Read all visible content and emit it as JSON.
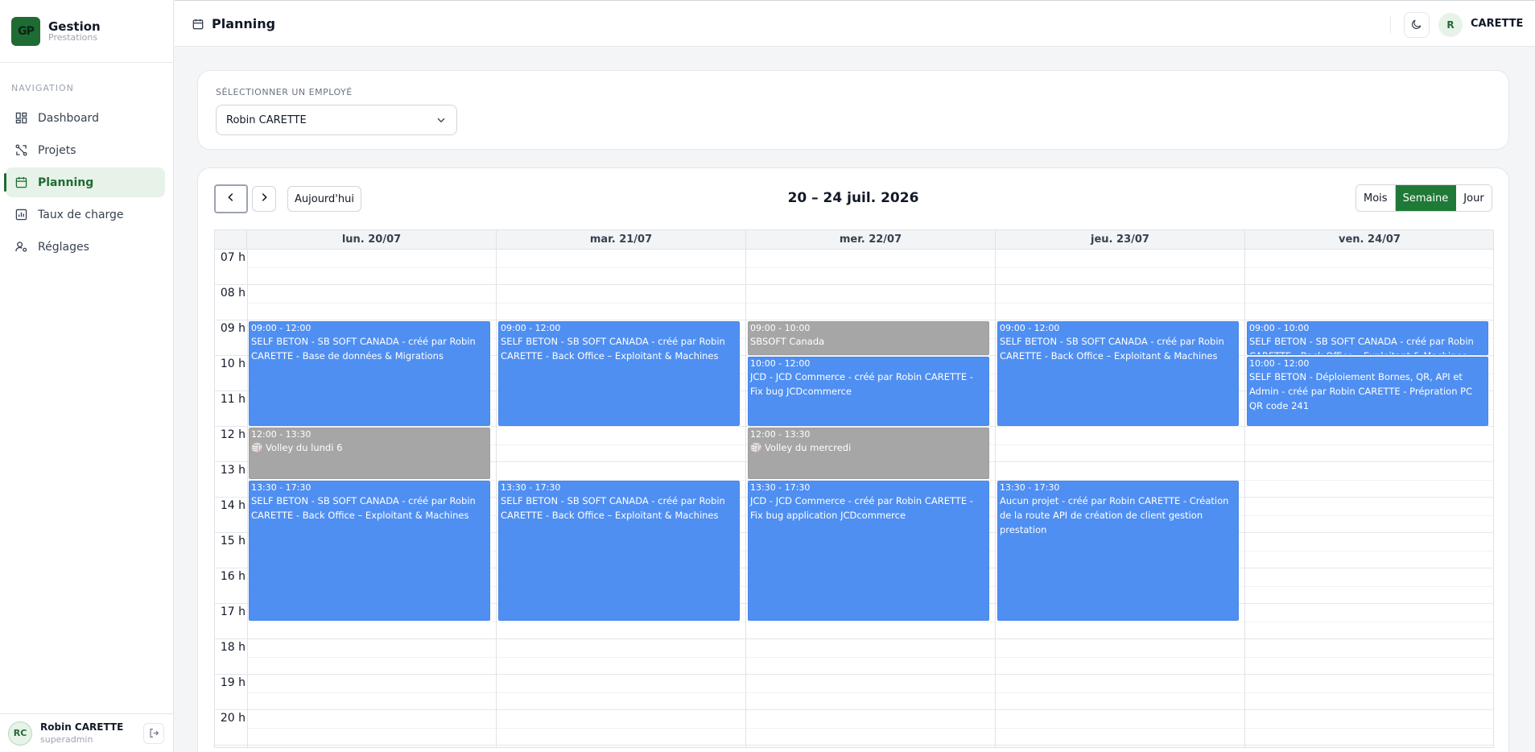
{
  "brand": {
    "logo": "GP",
    "title": "Gestion",
    "subtitle": "Prestations"
  },
  "nav": {
    "label": "NAVIGATION",
    "items": [
      {
        "label": "Dashboard",
        "icon": "dashboard-icon"
      },
      {
        "label": "Projets",
        "icon": "projects-icon"
      },
      {
        "label": "Planning",
        "icon": "calendar-icon",
        "active": true
      },
      {
        "label": "Taux de charge",
        "icon": "chart-icon"
      },
      {
        "label": "Réglages",
        "icon": "settings-icon"
      }
    ]
  },
  "user": {
    "initials": "RC",
    "name": "Robin CARETTE",
    "role": "superadmin"
  },
  "header": {
    "title": "Planning",
    "avatar": "R",
    "user": "CARETTE"
  },
  "employee": {
    "label": "SÉLECTIONNER UN EMPLOYÉ",
    "selected": "Robin CARETTE"
  },
  "calendar": {
    "today_label": "Aujourd'hui",
    "range_title": "20 – 24 juil. 2026",
    "views": [
      "Mois",
      "Semaine",
      "Jour"
    ],
    "active_view": "Semaine",
    "days": [
      "lun. 20/07",
      "mar. 21/07",
      "mer. 22/07",
      "jeu. 23/07",
      "ven. 24/07"
    ],
    "hours": [
      "07 h",
      "08 h",
      "09 h",
      "10 h",
      "11 h",
      "12 h",
      "13 h",
      "14 h",
      "15 h",
      "16 h",
      "17 h",
      "18 h",
      "19 h",
      "20 h"
    ],
    "events": [
      {
        "day": 0,
        "start": 9,
        "end": 12,
        "color": "blue",
        "time": "09:00 - 12:00",
        "title": "SELF BETON - SB SOFT CANADA - créé par Robin CARETTE - Base de données & Migrations"
      },
      {
        "day": 0,
        "start": 12,
        "end": 13.5,
        "color": "gray",
        "time": "12:00 - 13:30",
        "title": "🏐 Volley du lundi 6"
      },
      {
        "day": 0,
        "start": 13.5,
        "end": 17.5,
        "color": "blue",
        "time": "13:30 - 17:30",
        "title": "SELF BETON - SB SOFT CANADA - créé par Robin CARETTE - Back Office – Exploitant & Machines"
      },
      {
        "day": 1,
        "start": 9,
        "end": 12,
        "color": "blue",
        "time": "09:00 - 12:00",
        "title": "SELF BETON - SB SOFT CANADA - créé par Robin CARETTE - Back Office – Exploitant & Machines"
      },
      {
        "day": 1,
        "start": 13.5,
        "end": 17.5,
        "color": "blue",
        "time": "13:30 - 17:30",
        "title": "SELF BETON - SB SOFT CANADA - créé par Robin CARETTE - Back Office – Exploitant & Machines"
      },
      {
        "day": 2,
        "start": 9,
        "end": 10,
        "color": "gray",
        "time": "09:00 - 10:00",
        "title": "SBSOFT Canada"
      },
      {
        "day": 2,
        "start": 10,
        "end": 12,
        "color": "blue",
        "time": "10:00 - 12:00",
        "title": "JCD - JCD Commerce - créé par Robin CARETTE - Fix bug JCDcommerce"
      },
      {
        "day": 2,
        "start": 12,
        "end": 13.5,
        "color": "gray",
        "time": "12:00 - 13:30",
        "title": "🏐 Volley du mercredi"
      },
      {
        "day": 2,
        "start": 13.5,
        "end": 17.5,
        "color": "blue",
        "time": "13:30 - 17:30",
        "title": "JCD - JCD Commerce - créé par Robin CARETTE - Fix bug application JCDcommerce"
      },
      {
        "day": 3,
        "start": 9,
        "end": 12,
        "color": "blue",
        "time": "09:00 - 12:00",
        "title": "SELF BETON - SB SOFT CANADA - créé par Robin CARETTE - Back Office – Exploitant & Machines"
      },
      {
        "day": 3,
        "start": 13.5,
        "end": 17.5,
        "color": "blue",
        "time": "13:30 - 17:30",
        "title": "Aucun projet - créé par Robin CARETTE - Création de la route API de création de client gestion prestation"
      },
      {
        "day": 4,
        "start": 9,
        "end": 10,
        "color": "blue",
        "time": "09:00 - 10:00",
        "title": "SELF BETON - SB SOFT CANADA - créé par Robin CARETTE - Back Office – Exploitant & Machines"
      },
      {
        "day": 4,
        "start": 10,
        "end": 12,
        "color": "blue",
        "time": "10:00 - 12:00",
        "title": "SELF BETON - Déploiement Bornes, QR, API et Admin - créé par Robin CARETTE - Prépration PC QR code 241"
      }
    ]
  }
}
